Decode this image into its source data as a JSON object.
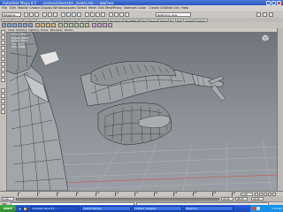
{
  "app": {
    "title": "Autodesk Maya 8.5 - ...scenes/character_model.mb --- lowFace"
  },
  "menubar": {
    "items": [
      "File",
      "Edit",
      "Modify",
      "Create",
      "Display",
      "Window",
      "Assets",
      "Select",
      "Mesh",
      "Edit Mesh",
      "Proxy",
      "Normals",
      "Color",
      "Create UVs",
      "Edit UVs",
      "Help"
    ],
    "mode": "Polygons"
  },
  "statusline": {
    "search_label": "Reflection Axis"
  },
  "shelf": {
    "tabs": [
      "General",
      "Curves",
      "Surfaces",
      "Polygons",
      "Subdivs",
      "Deformation",
      "Animation",
      "Dynamics",
      "Rendering",
      "PaintEffects",
      "Toon",
      "Muscle",
      "Fluids",
      "Fur",
      "Hair",
      "nCloth",
      "Custom"
    ],
    "active_tab": "Polygons"
  },
  "viewport": {
    "menu": [
      "View",
      "Shading",
      "Lighting",
      "Show",
      "Renderer",
      "Panels"
    ],
    "hud": [
      {
        "label": "Verts:",
        "value": "3274"
      },
      {
        "label": "Edges:",
        "value": "6583"
      },
      {
        "label": "Faces:",
        "value": "3314"
      },
      {
        "label": "Tris:",
        "value": "6522"
      },
      {
        "label": "UVs:",
        "value": "3586"
      }
    ],
    "colors": {
      "background": "#7d8288",
      "mesh_fill": "#9fa3a7",
      "mesh_wire": "#1f2125",
      "grid": "#b9bcc0",
      "grid_axis": "#d05050"
    }
  },
  "timeslider": {
    "ticks": [
      "2",
      "4",
      "6",
      "8",
      "10",
      "12",
      "14",
      "16",
      "18",
      "20",
      "22",
      "24"
    ],
    "current_frame": "1.00",
    "end_frame": "24.00"
  },
  "rangeslider": {
    "start": "1.00",
    "end": "24.00",
    "anim_end": "48.00"
  },
  "cmdline": {
    "label": "MEL"
  },
  "taskbar": {
    "start_label": "start",
    "buttons": [
      "Autodesk Maya 8.5 - ...",
      "Output Window",
      "Untitled - Notepad",
      "Maya 8.5 -"
    ],
    "clock": "3:23 PM"
  }
}
